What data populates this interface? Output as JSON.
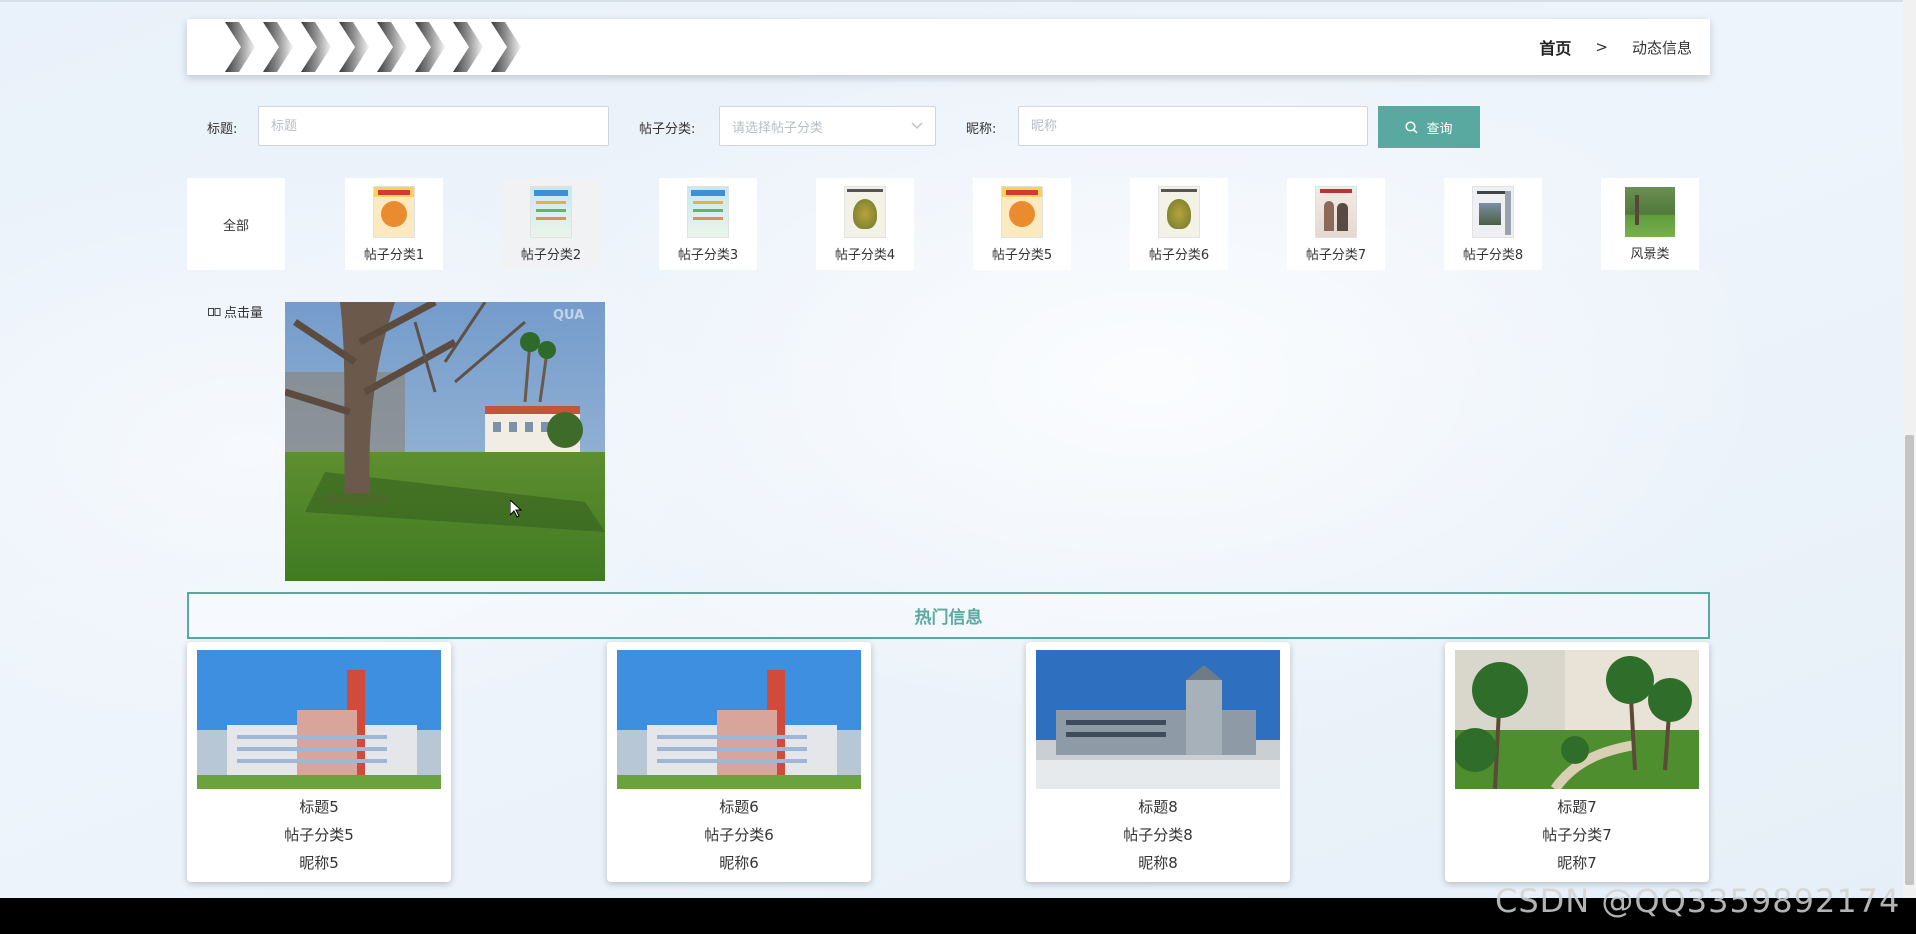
{
  "header": {
    "breadcrumb": {
      "home": "首页",
      "separator": ">",
      "current": "动态信息"
    }
  },
  "search": {
    "title_label": "标题:",
    "title_placeholder": "标题",
    "category_label": "帖子分类:",
    "category_placeholder": "请选择帖子分类",
    "nickname_label": "昵称:",
    "nickname_placeholder": "昵称",
    "button_label": "查询",
    "button_color": "#5aa9a1"
  },
  "categories": [
    {
      "label": "全部"
    },
    {
      "label": "帖子分类1"
    },
    {
      "label": "帖子分类2",
      "active": true
    },
    {
      "label": "帖子分类3"
    },
    {
      "label": "帖子分类4"
    },
    {
      "label": "帖子分类5"
    },
    {
      "label": "帖子分类6"
    },
    {
      "label": "帖子分类7"
    },
    {
      "label": "帖子分类8"
    },
    {
      "label": "风景类"
    }
  ],
  "main": {
    "hits_label": "点击量",
    "photo_watermark": "QUA"
  },
  "hot": {
    "title": "热门信息",
    "cards": [
      {
        "title": "标题5",
        "category": "帖子分类5",
        "nickname": "昵称5"
      },
      {
        "title": "标题6",
        "category": "帖子分类6",
        "nickname": "昵称6"
      },
      {
        "title": "标题8",
        "category": "帖子分类8",
        "nickname": "昵称8"
      },
      {
        "title": "标题7",
        "category": "帖子分类7",
        "nickname": "昵称7"
      }
    ]
  },
  "watermark": "CSDN @QQ3359892174",
  "colors": {
    "accent": "#5aa9a1",
    "footer": "#000000"
  }
}
